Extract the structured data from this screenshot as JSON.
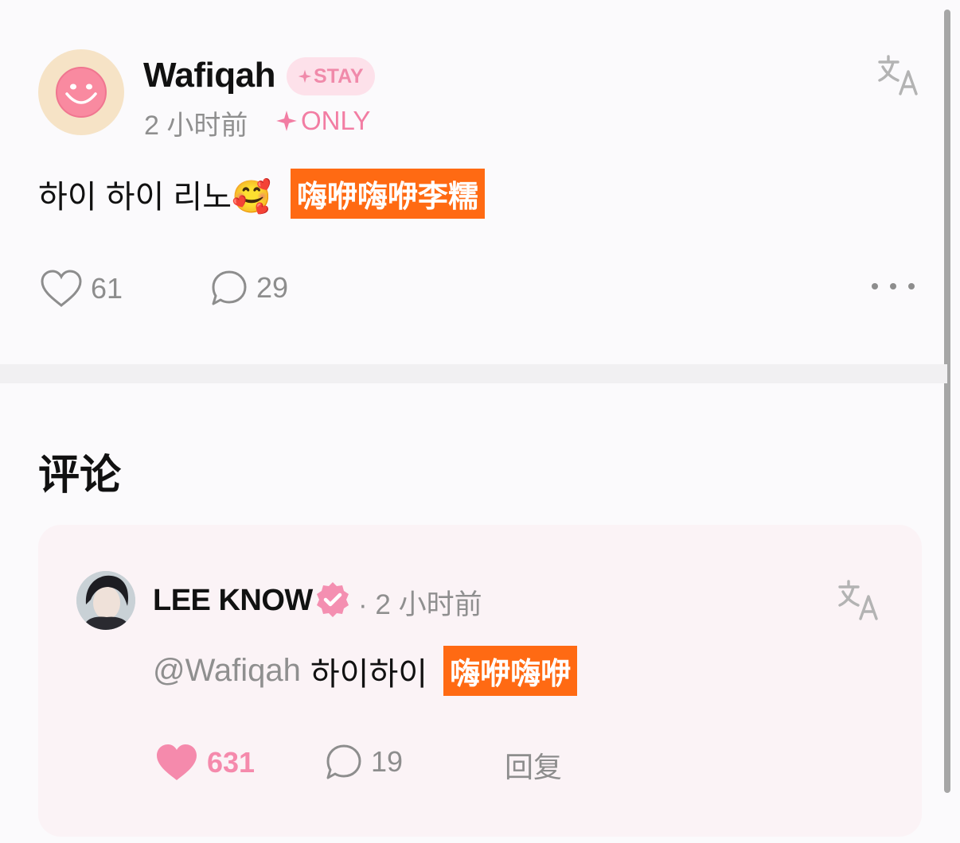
{
  "post": {
    "author": {
      "name": "Wafiqah",
      "badge": "STAY",
      "avatar_icon": "smiley-face-icon"
    },
    "time": "2 小时前",
    "visibility_tag": "ONLY",
    "text": "하이 하이 리노🥰",
    "translation": "嗨咿嗨咿李糯",
    "likes": "61",
    "comments": "29"
  },
  "comments_section": {
    "title": "评论",
    "items": [
      {
        "author": "LEE KNOW",
        "verified": true,
        "time": "· 2 小时前",
        "mention": "@Wafiqah",
        "text": "하이하이",
        "translation": "嗨咿嗨咿",
        "likes": "631",
        "liked": true,
        "replies": "19",
        "reply_label": "回复"
      }
    ]
  },
  "colors": {
    "accent_pink": "#f27da3",
    "translation_bg": "#ff6a13",
    "muted_text": "#8d8d8d"
  }
}
